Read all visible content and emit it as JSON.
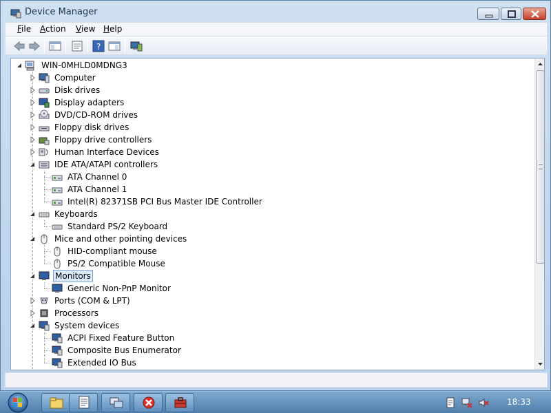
{
  "window": {
    "title": "Device Manager",
    "colors": {
      "accent": "#dcebfc",
      "close": "#c5412a"
    }
  },
  "menu": {
    "items": [
      "File",
      "Action",
      "View",
      "Help"
    ]
  },
  "toolbar": {
    "icons": [
      "back-arrow-icon",
      "forward-arrow-icon",
      "show-hide-console-tree-icon",
      "properties-icon",
      "help-icon",
      "show-action-pane-icon",
      "update-driver-icon"
    ]
  },
  "tree": {
    "root": "WIN-0MHLD0MDNG3",
    "rows": [
      {
        "label": "Computer",
        "icon": "computer-icon",
        "state": "collapsed"
      },
      {
        "label": "Disk drives",
        "icon": "disk-drive-icon",
        "state": "collapsed"
      },
      {
        "label": "Display adapters",
        "icon": "display-adapter-icon",
        "state": "collapsed"
      },
      {
        "label": "DVD/CD-ROM drives",
        "icon": "dvd-drive-icon",
        "state": "collapsed"
      },
      {
        "label": "Floppy disk drives",
        "icon": "floppy-drive-icon",
        "state": "collapsed"
      },
      {
        "label": "Floppy drive controllers",
        "icon": "floppy-controller-icon",
        "state": "collapsed"
      },
      {
        "label": "Human Interface Devices",
        "icon": "hid-icon",
        "state": "collapsed"
      },
      {
        "label": "IDE ATA/ATAPI controllers",
        "icon": "ide-controller-icon",
        "state": "expanded"
      },
      {
        "label": "ATA Channel 0",
        "icon": "ide-channel-icon",
        "child": true
      },
      {
        "label": "ATA Channel 1",
        "icon": "ide-channel-icon",
        "child": true
      },
      {
        "label": "Intel(R) 82371SB PCI Bus Master IDE Controller",
        "icon": "ide-channel-icon",
        "child": true
      },
      {
        "label": "Keyboards",
        "icon": "keyboard-icon",
        "state": "expanded"
      },
      {
        "label": "Standard PS/2 Keyboard",
        "icon": "keyboard-icon",
        "child": true
      },
      {
        "label": "Mice and other pointing devices",
        "icon": "mouse-icon",
        "state": "expanded"
      },
      {
        "label": "HID-compliant mouse",
        "icon": "mouse-icon",
        "child": true
      },
      {
        "label": "PS/2 Compatible Mouse",
        "icon": "mouse-icon",
        "child": true
      },
      {
        "label": "Monitors",
        "icon": "monitor-icon",
        "state": "expanded",
        "selected": true
      },
      {
        "label": "Generic Non-PnP Monitor",
        "icon": "monitor-icon",
        "child": true
      },
      {
        "label": "Ports (COM & LPT)",
        "icon": "port-icon",
        "state": "collapsed"
      },
      {
        "label": "Processors",
        "icon": "processor-icon",
        "state": "collapsed"
      },
      {
        "label": "System devices",
        "icon": "system-device-icon",
        "state": "expanded"
      },
      {
        "label": "ACPI Fixed Feature Button",
        "icon": "system-device-icon",
        "child": true
      },
      {
        "label": "Composite Bus Enumerator",
        "icon": "system-device-icon",
        "child": true
      },
      {
        "label": "Extended IO Bus",
        "icon": "system-device-icon",
        "child": true
      }
    ]
  },
  "taskbar": {
    "buttons": [
      "explorer-icon",
      "notepad-icon",
      "network-icon",
      "error-icon",
      "toolbox-icon"
    ],
    "tray_icons": [
      "document-icon",
      "network-disconnected-icon",
      "volume-muted-icon"
    ],
    "clock": "18:33"
  }
}
